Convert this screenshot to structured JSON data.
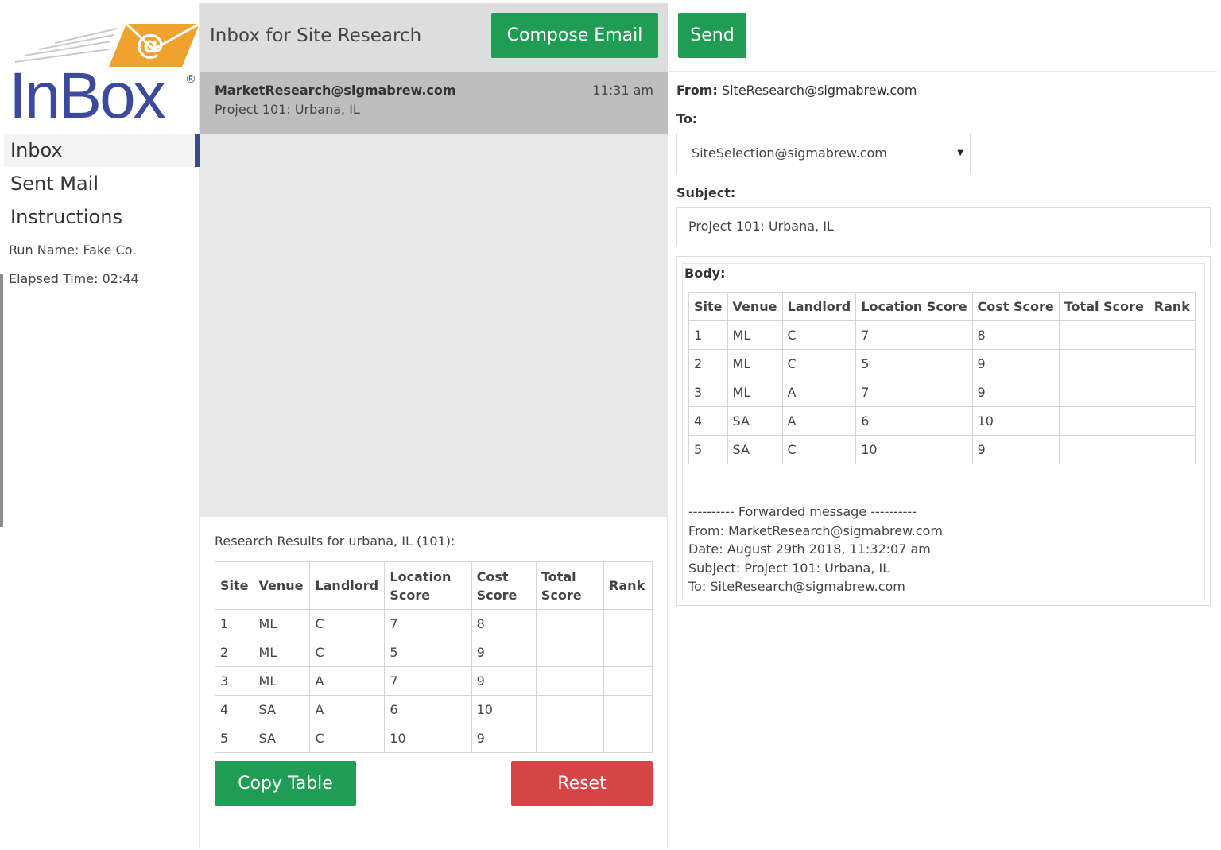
{
  "logo": {
    "text": "InBox",
    "registered": "®"
  },
  "nav": {
    "items": [
      {
        "label": "Inbox"
      },
      {
        "label": "Sent Mail"
      },
      {
        "label": "Instructions"
      }
    ],
    "run_name": "Run Name: Fake Co.",
    "elapsed_time": "Elapsed Time: 02:44"
  },
  "inbox": {
    "title": "Inbox for Site Research",
    "compose_label": "Compose Email",
    "messages": [
      {
        "from": "MarketResearch@sigmabrew.com",
        "subject": "Project 101: Urbana, IL",
        "time": "11:31 am"
      }
    ]
  },
  "results": {
    "title": "Research Results for urbana, IL (101):",
    "headers": [
      "Site",
      "Venue",
      "Landlord",
      "Location Score",
      "Cost Score",
      "Total Score",
      "Rank"
    ],
    "rows": [
      [
        "1",
        "ML",
        "C",
        "7",
        "8",
        "",
        ""
      ],
      [
        "2",
        "ML",
        "C",
        "5",
        "9",
        "",
        ""
      ],
      [
        "3",
        "ML",
        "A",
        "7",
        "9",
        "",
        ""
      ],
      [
        "4",
        "SA",
        "A",
        "6",
        "10",
        "",
        ""
      ],
      [
        "5",
        "SA",
        "C",
        "10",
        "9",
        "",
        ""
      ]
    ],
    "copy_label": "Copy Table",
    "reset_label": "Reset"
  },
  "compose": {
    "send_label": "Send",
    "from_label": "From:",
    "from_value": "SiteResearch@sigmabrew.com",
    "to_label": "To:",
    "to_value": "SiteSelection@sigmabrew.com",
    "subject_label": "Subject:",
    "subject_value": "Project 101:  Urbana, IL",
    "body_label": "Body:",
    "forwarded": {
      "separator": "---------- Forwarded message ----------",
      "from": "From: MarketResearch@sigmabrew.com",
      "date": "Date: August 29th 2018, 11:32:07 am",
      "subject": "Subject: Project 101: Urbana, IL",
      "to": "To: SiteResearch@sigmabrew.com"
    }
  },
  "colors": {
    "green": "#1f9d55",
    "red": "#d64545",
    "logo_blue": "#3c4a9e",
    "logo_orange": "#f0a22e"
  }
}
